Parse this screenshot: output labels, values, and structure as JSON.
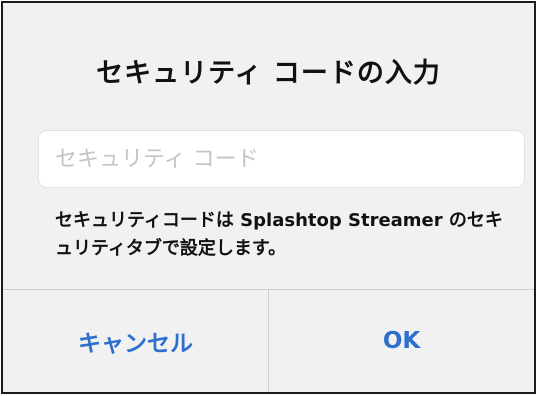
{
  "dialog": {
    "title": "セキュリティ コードの入力",
    "input": {
      "value": "",
      "placeholder": "セキュリティ コード"
    },
    "message": "セキュリティコードは Splashtop Streamer のセキュリティタブで設定します。",
    "buttons": {
      "cancel_label": "キャンセル",
      "ok_label": "OK"
    }
  },
  "colors": {
    "dialog_background": "#f1f1f2",
    "button_text": "#2e6fce",
    "separator": "#cfcfd1",
    "placeholder": "#c4c4c6"
  }
}
